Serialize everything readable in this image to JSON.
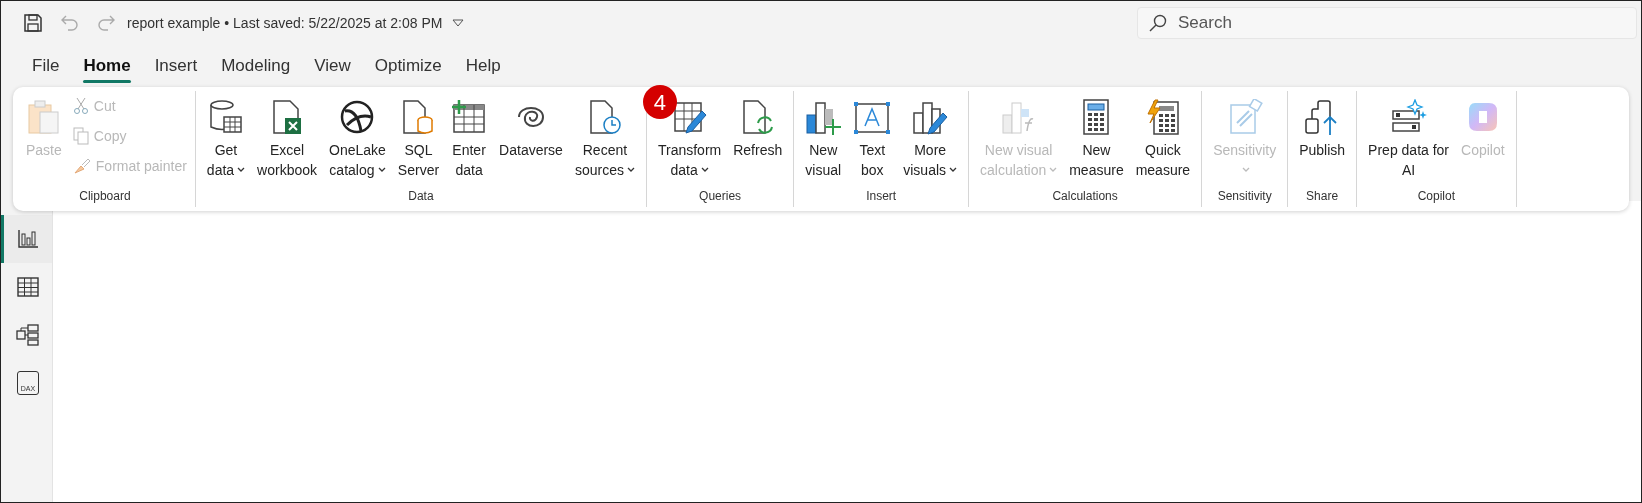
{
  "title_bar": {
    "title": "report example • Last saved: 5/22/2025 at 2:08 PM",
    "search": {
      "placeholder": "Search"
    }
  },
  "tabs": [
    {
      "label": "File",
      "selected": false
    },
    {
      "label": "Home",
      "selected": true
    },
    {
      "label": "Insert",
      "selected": false
    },
    {
      "label": "Modeling",
      "selected": false
    },
    {
      "label": "View",
      "selected": false
    },
    {
      "label": "Optimize",
      "selected": false
    },
    {
      "label": "Help",
      "selected": false
    }
  ],
  "ribbon": {
    "groups": [
      {
        "label": "Clipboard",
        "buttons": [
          {
            "kind": "large",
            "lines": [
              "Paste"
            ],
            "caret": false,
            "disabled": true
          },
          {
            "kind": "small",
            "lines": [
              "Cut"
            ],
            "disabled": true
          },
          {
            "kind": "small",
            "lines": [
              "Copy"
            ],
            "disabled": true
          },
          {
            "kind": "small",
            "lines": [
              "Format painter"
            ],
            "disabled": true
          }
        ]
      },
      {
        "label": "Data",
        "buttons": [
          {
            "kind": "large",
            "lines": [
              "Get",
              "data"
            ],
            "caret": true,
            "disabled": false
          },
          {
            "kind": "large",
            "lines": [
              "Excel",
              "workbook"
            ],
            "caret": false,
            "disabled": false
          },
          {
            "kind": "large",
            "lines": [
              "OneLake",
              "catalog"
            ],
            "caret": true,
            "disabled": false
          },
          {
            "kind": "large",
            "lines": [
              "SQL",
              "Server"
            ],
            "caret": false,
            "disabled": false
          },
          {
            "kind": "large",
            "lines": [
              "Enter",
              "data"
            ],
            "caret": false,
            "disabled": false
          },
          {
            "kind": "large",
            "lines": [
              "Dataverse"
            ],
            "caret": false,
            "disabled": false
          },
          {
            "kind": "large",
            "lines": [
              "Recent",
              "sources"
            ],
            "caret": true,
            "disabled": false
          }
        ]
      },
      {
        "label": "Queries",
        "buttons": [
          {
            "kind": "large",
            "lines": [
              "Transform",
              "data"
            ],
            "caret": true,
            "disabled": false,
            "badge": "4"
          },
          {
            "kind": "large",
            "lines": [
              "Refresh"
            ],
            "caret": false,
            "disabled": false
          }
        ]
      },
      {
        "label": "Insert",
        "buttons": [
          {
            "kind": "large",
            "lines": [
              "New",
              "visual"
            ],
            "caret": false,
            "disabled": false
          },
          {
            "kind": "large",
            "lines": [
              "Text",
              "box"
            ],
            "caret": false,
            "disabled": false
          },
          {
            "kind": "large",
            "lines": [
              "More",
              "visuals"
            ],
            "caret": true,
            "disabled": false
          }
        ]
      },
      {
        "label": "Calculations",
        "buttons": [
          {
            "kind": "large",
            "lines": [
              "New visual",
              "calculation"
            ],
            "caret": true,
            "disabled": true
          },
          {
            "kind": "large",
            "lines": [
              "New",
              "measure"
            ],
            "caret": false,
            "disabled": false
          },
          {
            "kind": "large",
            "lines": [
              "Quick",
              "measure"
            ],
            "caret": false,
            "disabled": false
          }
        ]
      },
      {
        "label": "Sensitivity",
        "buttons": [
          {
            "kind": "large",
            "lines": [
              "Sensitivity"
            ],
            "caret": true,
            "disabled": true
          }
        ]
      },
      {
        "label": "Share",
        "buttons": [
          {
            "kind": "large",
            "lines": [
              "Publish"
            ],
            "caret": false,
            "disabled": false
          }
        ]
      },
      {
        "label": "Copilot",
        "buttons": [
          {
            "kind": "large",
            "lines": [
              "Prep data for",
              "AI"
            ],
            "caret": false,
            "disabled": false
          },
          {
            "kind": "large",
            "lines": [
              "Copilot"
            ],
            "caret": false,
            "disabled": true
          }
        ]
      }
    ]
  },
  "view_rail": [
    {
      "selected": true
    },
    {
      "selected": false
    },
    {
      "selected": false
    },
    {
      "selected": false,
      "icon_text": "DAX"
    }
  ]
}
